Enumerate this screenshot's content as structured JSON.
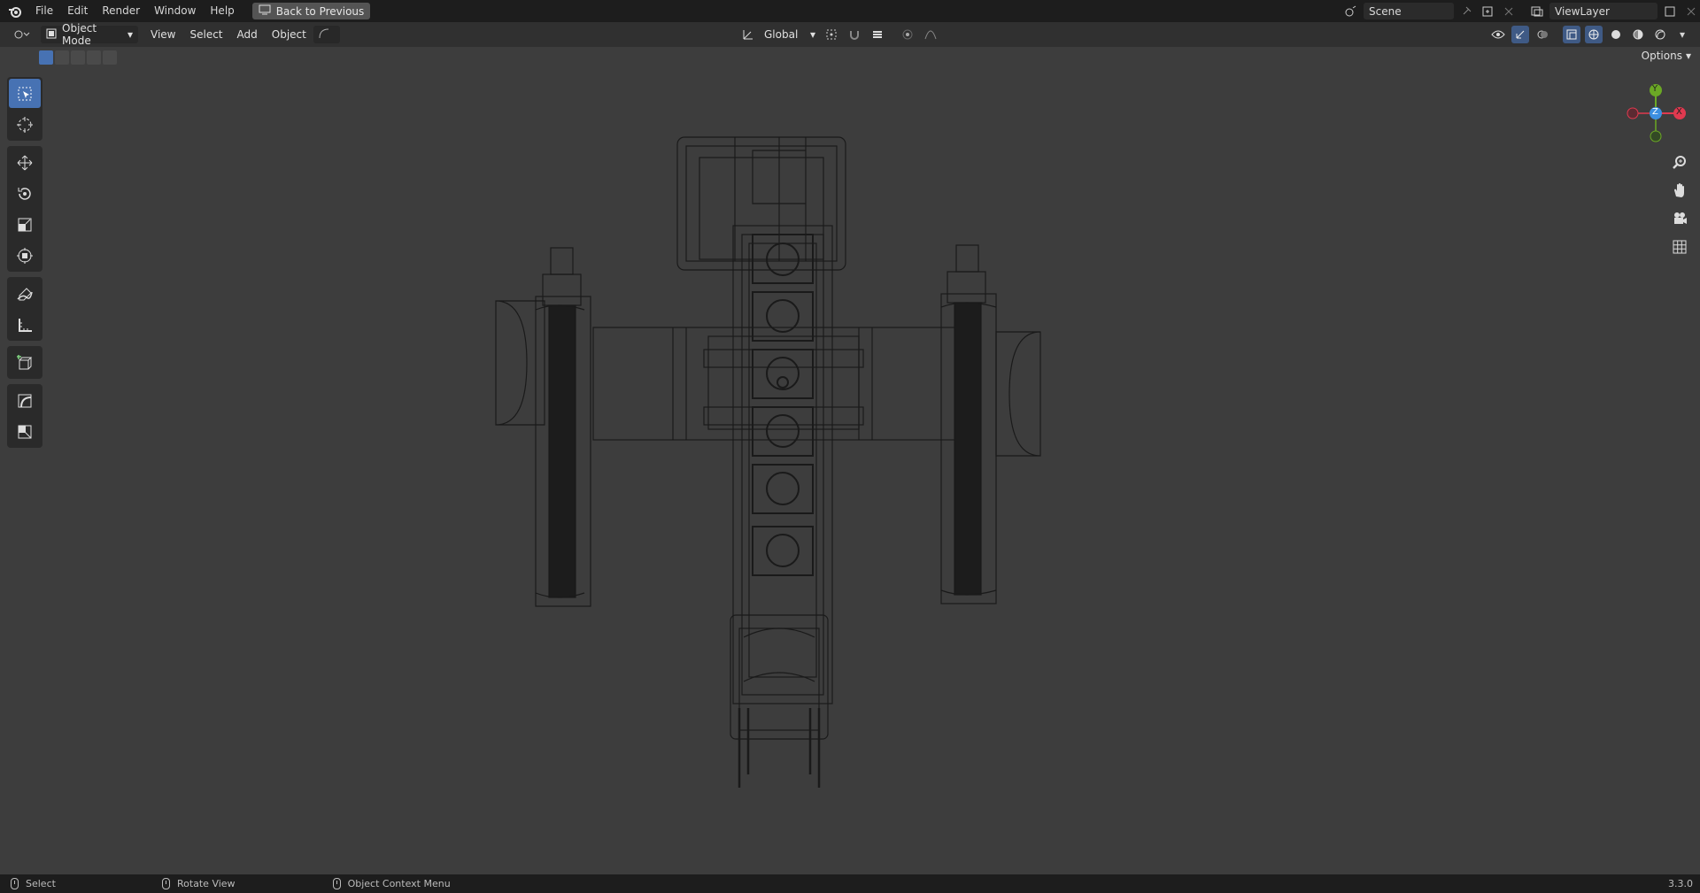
{
  "topbar": {
    "menus": [
      "File",
      "Edit",
      "Render",
      "Window",
      "Help"
    ],
    "back_button": "Back to Previous",
    "scene": "Scene",
    "view_layer": "ViewLayer"
  },
  "header": {
    "mode": "Object Mode",
    "menus": [
      "View",
      "Select",
      "Add",
      "Object"
    ],
    "transform_orientation": "Global"
  },
  "subheader": {
    "options": "Options"
  },
  "gizmo": {
    "axes": [
      "X",
      "Y",
      "Z"
    ],
    "colors": {
      "x": "#e0394f",
      "y": "#6ba825",
      "z": "#3d8fe0"
    }
  },
  "statusbar": {
    "left_click": "Select",
    "middle_click": "Rotate View",
    "right_click": "Object Context Menu",
    "version": "3.3.0"
  },
  "icons": {
    "toolbar": [
      "select-box-icon",
      "cursor-icon",
      "move-icon",
      "rotate-icon",
      "scale-icon",
      "transform-icon",
      "annotate-icon",
      "measure-icon",
      "add-cube-icon",
      "extrude-icon",
      "inset-icon"
    ],
    "navigation": [
      "zoom-icon",
      "pan-icon",
      "camera-icon",
      "grid-icon"
    ]
  }
}
